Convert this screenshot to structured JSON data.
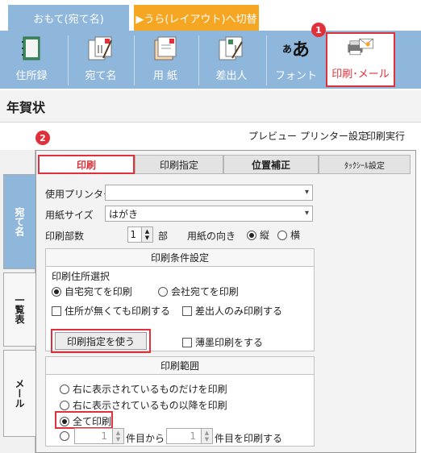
{
  "top_tabs": {
    "front": "おもて(宛て名)",
    "back": "▶うら(レイアウト)へ切替"
  },
  "toolbar": {
    "items": [
      {
        "label": "住所録",
        "icon": "address-book-icon"
      },
      {
        "label": "宛て名",
        "icon": "envelope-pen-icon"
      },
      {
        "label": "用 紙",
        "icon": "paper-icon"
      },
      {
        "label": "差出人",
        "icon": "sender-icon"
      },
      {
        "label": "フォント",
        "icon": "font-icon"
      },
      {
        "label": "印刷･メール",
        "icon": "printer-mail-icon"
      }
    ],
    "badge1": "1"
  },
  "page_title": "年賀状",
  "actions": {
    "preview": "プレビュー",
    "printer_settings": "プリンター設定",
    "print_run": "印刷実行"
  },
  "badge2": "2",
  "side_tabs": {
    "addressee": "宛て名",
    "list": "一覧表",
    "mail": "メール"
  },
  "sub_tabs": {
    "print": "印刷",
    "print_spec": "印刷指定",
    "position": "位置補正",
    "tack_seal": "ﾀｯｸｼｰﾙ設定"
  },
  "form": {
    "printer_label": "使用プリンター",
    "printer_value": "",
    "paper_size_label": "用紙サイズ",
    "paper_size_value": "はがき",
    "copies_label": "印刷部数",
    "copies_value": "1",
    "copies_unit": "部",
    "orientation_label": "用紙の向き",
    "orientation_portrait": "縦",
    "orientation_landscape": "横"
  },
  "conditions": {
    "title": "印刷条件設定",
    "address_select_label": "印刷住所選択",
    "home": "自宅宛てを印刷",
    "company": "会社宛てを印刷",
    "no_address": "住所が無くても印刷する",
    "sender_only": "差出人のみ印刷する",
    "use_spec_button": "印刷指定を使う",
    "thin_paper": "薄墨印刷をする"
  },
  "range": {
    "title": "印刷範囲",
    "only_shown": "右に表示されているものだけを印刷",
    "after_shown": "右に表示されているもの以降を印刷",
    "all": "全て印刷",
    "from_value": "1",
    "from_label": "件目から",
    "to_value": "1",
    "to_label": "件目を印刷する"
  },
  "colors": {
    "accent_blue": "#8fb6db",
    "accent_orange": "#f5a623",
    "highlight_red": "#e0303a"
  }
}
